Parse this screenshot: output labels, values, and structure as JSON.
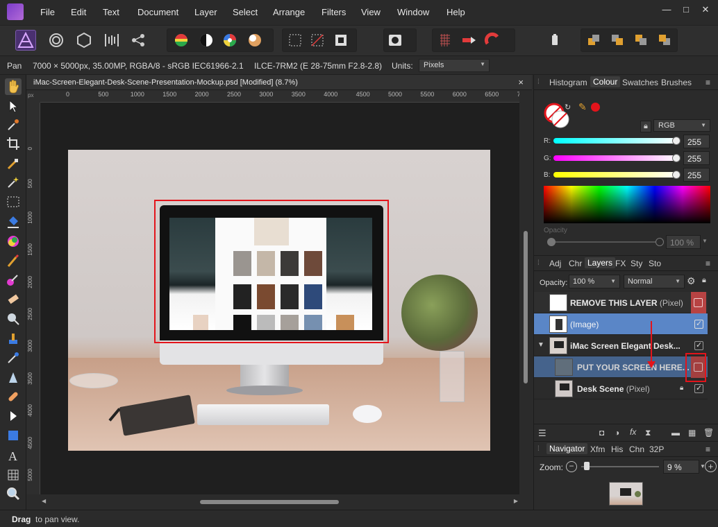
{
  "menubar": {
    "items": [
      "File",
      "Edit",
      "Text",
      "Document",
      "Layer",
      "Select",
      "Arrange",
      "Filters",
      "View",
      "Window",
      "Help"
    ]
  },
  "context": {
    "tool": "Pan",
    "doc_info": "7000 × 5000px, 35.00MP, RGBA/8 - sRGB IEC61966-2.1",
    "camera": "ILCE-7RM2 (E 28-75mm F2.8-2.8)",
    "units_label": "Units:",
    "units_value": "Pixels"
  },
  "document": {
    "title": "iMac-Screen-Elegant-Desk-Scene-Presentation-Mockup.psd [Modified] (8.7%)",
    "close": "×",
    "ruler_unit": "px",
    "ruler_top": [
      "0",
      "500",
      "1000",
      "1500",
      "2000",
      "2500",
      "3000",
      "3500",
      "4000",
      "4500",
      "5000",
      "5500",
      "6000",
      "6500",
      "7000"
    ],
    "ruler_left": [
      "0",
      "500",
      "1000",
      "1500",
      "2000",
      "2500",
      "3000",
      "3500",
      "4000",
      "4500",
      "5000"
    ]
  },
  "colour_panel": {
    "tabs": [
      "Histogram",
      "Colour",
      "Swatches",
      "Brushes"
    ],
    "active_tab": "Colour",
    "model": "RGB",
    "r_label": "R:",
    "r_value": "255",
    "g_label": "G:",
    "g_value": "255",
    "b_label": "B:",
    "b_value": "255",
    "opacity_label": "Opacity",
    "opacity_value": "100 %"
  },
  "layers_panel": {
    "tabs": [
      "Adj",
      "Chr",
      "Layers",
      "FX",
      "Sty",
      "Sto"
    ],
    "active_tab": "Layers",
    "opacity_label": "Opacity:",
    "opacity_value": "100 %",
    "blend_mode": "Normal",
    "layers": [
      {
        "name": "REMOVE THIS LAYER",
        "kind": "(Pixel)"
      },
      {
        "name": "(Image)",
        "kind": ""
      },
      {
        "name": "iMac Screen Elegant Desk...",
        "kind": ""
      },
      {
        "name": "PUT YOUR SCREEN HERE...",
        "kind": ""
      },
      {
        "name": "Desk Scene",
        "kind": "(Pixel)"
      }
    ]
  },
  "navigator_panel": {
    "tabs": [
      "Navigator",
      "Xfm",
      "His",
      "Chn",
      "32P"
    ],
    "active_tab": "Navigator",
    "zoom_label": "Zoom:",
    "zoom_value": "9 %"
  },
  "status": {
    "bold": "Drag",
    "text": "to pan view."
  },
  "colors": {
    "accent_selection": "#5a86c7",
    "annotation_red": "#e3141b",
    "layer_red": "#b84343"
  }
}
